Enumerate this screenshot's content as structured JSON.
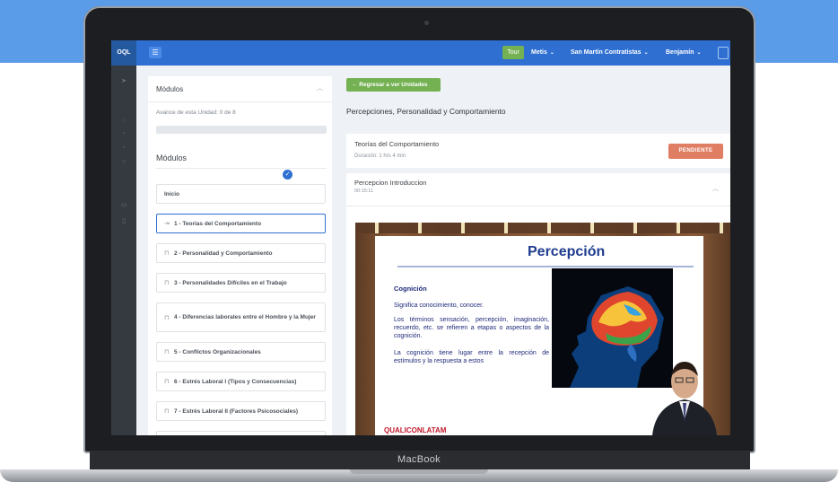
{
  "topbar": {
    "brand": "OQL",
    "tour_label": "Tour",
    "nav": [
      "Metis",
      "San Martín Contratistas",
      "Benjamín"
    ]
  },
  "modules_panel": {
    "title": "Módulos",
    "progress_text": "Avance de esta Unidad: 0 de 8",
    "progress_fraction": 0,
    "subtitle": "Módulos",
    "items": [
      {
        "label": "Inicio",
        "icon": "none"
      },
      {
        "label": "1 - Teorías del Comportamiento",
        "icon": "entry-icon"
      },
      {
        "label": "2 - Personalidad y Comportamiento",
        "icon": "lock-icon"
      },
      {
        "label": "3 - Personalidades Difíciles en el Trabajo",
        "icon": "lock-icon"
      },
      {
        "label": "4 - Diferencias laborales entre el Hombre y la Mujer",
        "icon": "lock-icon"
      },
      {
        "label": "5 - Conflictos Organizacionales",
        "icon": "lock-icon"
      },
      {
        "label": "6 - Estrés Laboral I (Tipos y Consecuencias)",
        "icon": "lock-icon"
      },
      {
        "label": "7 - Estrés Laboral II (Factores Psicosociales)",
        "icon": "lock-icon"
      }
    ]
  },
  "content": {
    "back_button": "← Regresar a ver Unidades",
    "unit_title": "Percepciones, Personalidad y Comportamiento",
    "module_title": "Teorías del Comportamiento",
    "module_duration": "Duración: 1 hrs 4 min",
    "status_badge": "PENDIENTE",
    "lesson_title": "Percepcion Introduccion",
    "lesson_time": "00:15:11"
  },
  "slide": {
    "heading": "Percepción",
    "subheading": "Cognición",
    "line1": "Significa conocimiento, conocer.",
    "line2": "Los términos sensación, percepción, imaginación, recuerdo, etc. se refieren a etapas o aspectos de la cognición.",
    "line3": "La cognición tiene lugar entre la recepción de estímulos y la respuesta a estos",
    "logo": "QUALICONLATAM"
  },
  "device": {
    "label": "MacBook"
  },
  "colors": {
    "topbar": "#2f6fd1",
    "sidebar": "#343a40",
    "green": "#74b152",
    "pending": "#e07e64"
  }
}
